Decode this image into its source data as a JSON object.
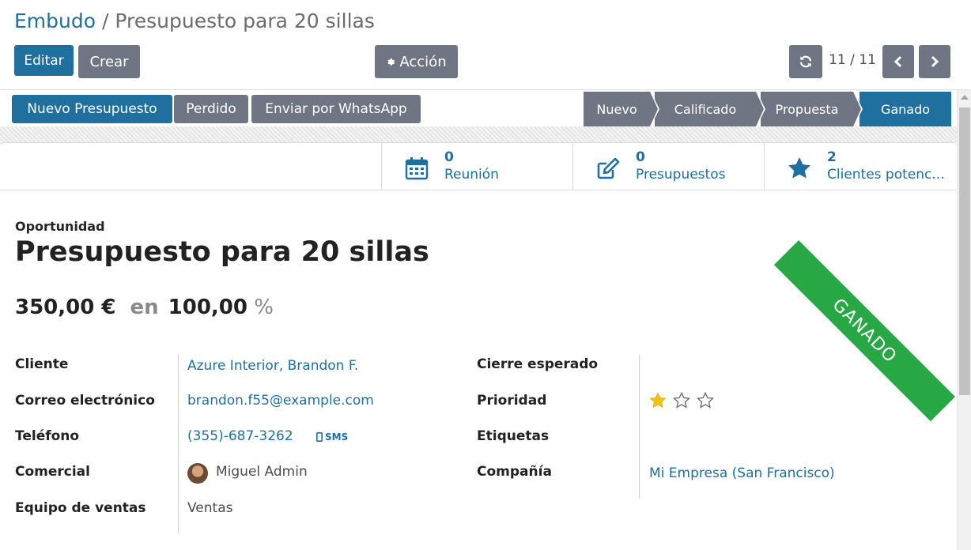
{
  "breadcrumb": {
    "parent": "Embudo",
    "separator": "/",
    "current": "Presupuesto para 20 sillas"
  },
  "toolbar": {
    "edit_label": "Editar",
    "create_label": "Crear",
    "action_label": "Acción",
    "pager": "11 / 11"
  },
  "statusbar": {
    "buttons": [
      "Nuevo Presupuesto",
      "Perdido",
      "Enviar por WhatsApp"
    ],
    "stages": [
      "Nuevo",
      "Calificado",
      "Propuesta",
      "Ganado"
    ],
    "active_stage": "Ganado"
  },
  "smart_buttons": [
    {
      "count": "0",
      "label": "Reunión",
      "icon": "calendar-icon"
    },
    {
      "count": "0",
      "label": "Presupuestos",
      "icon": "edit-icon"
    },
    {
      "count": "2",
      "label": "Clientes potenc...",
      "icon": "star-icon"
    }
  ],
  "ribbon": "GANADO",
  "form": {
    "type_label": "Oportunidad",
    "title": "Presupuesto para 20 sillas",
    "revenue": "350,00 €",
    "en": "en",
    "probability": "100,00",
    "percent": "%",
    "left": [
      {
        "label": "Cliente",
        "value": "Azure Interior, Brandon F."
      },
      {
        "label": "Correo electrónico",
        "value": "brandon.f55@example.com"
      },
      {
        "label": "Teléfono",
        "value": "(355)-687-3262",
        "action": "SMS"
      },
      {
        "label": "Comercial",
        "value": "Miguel Admin"
      },
      {
        "label": "Equipo de ventas",
        "value": "Ventas"
      }
    ],
    "right": [
      {
        "label": "Cierre esperado",
        "value": ""
      },
      {
        "label": "Prioridad",
        "value": "",
        "stars_filled": 1,
        "stars_total": 3
      },
      {
        "label": "Etiquetas",
        "value": ""
      },
      {
        "label": "Compañía",
        "value": "Mi Empresa (San Francisco)"
      }
    ]
  },
  "colors": {
    "primary": "#1f6f9f",
    "secondary": "#6f7583",
    "ribbon": "#28a745",
    "star": "#f3c312"
  }
}
